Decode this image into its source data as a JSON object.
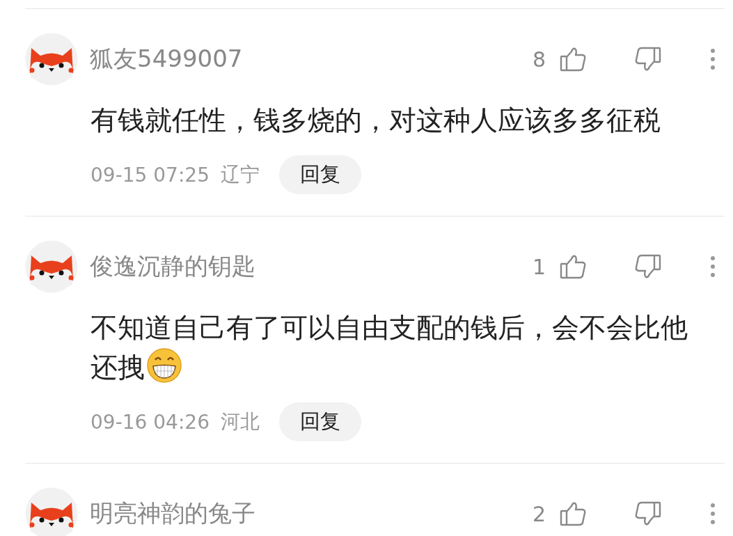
{
  "comments": [
    {
      "user": "狐友5499007",
      "likes": "8",
      "text_lines": [
        "有钱就任性，钱多烧的，对这种人应该多多征税"
      ],
      "time": "09-15 07:25",
      "location": "辽宁",
      "reply": "回复"
    },
    {
      "user": "俊逸沉静的钥匙",
      "likes": "1",
      "text_lines": [
        "不知道自己有了可以自由支配的钱后，会不会比他",
        "还拽"
      ],
      "emoji": true,
      "time": "09-16 04:26",
      "location": "河北",
      "reply": "回复"
    },
    {
      "user": "明亮神韵的兔子",
      "likes": "2"
    }
  ]
}
